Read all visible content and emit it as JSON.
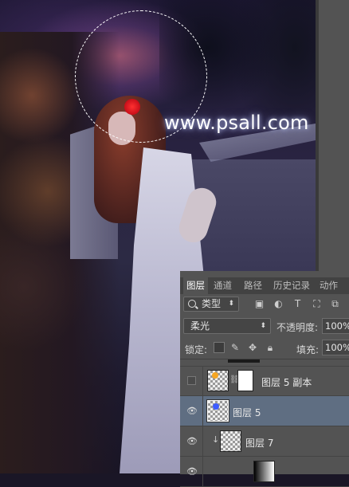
{
  "canvas": {
    "watermark_text": "www.psall.com"
  },
  "panel": {
    "tabs": [
      {
        "label": "图层",
        "active": true
      },
      {
        "label": "通道",
        "active": false
      },
      {
        "label": "路径",
        "active": false
      },
      {
        "label": "历史记录",
        "active": false
      },
      {
        "label": "动作",
        "active": false
      }
    ],
    "filter": {
      "kind_label": "类型",
      "icons": [
        "image-filter-icon",
        "adjustment-filter-icon",
        "type-filter-icon",
        "shape-filter-icon",
        "smart-object-filter-icon"
      ]
    },
    "blend_mode": "柔光",
    "opacity_label": "不透明度:",
    "opacity_value": "100%",
    "lock_label": "锁定:",
    "fill_label": "填充:",
    "fill_value": "100%",
    "layers": [
      {
        "name": "图层 5 副本",
        "visible": false,
        "selected": false,
        "has_mask": true
      },
      {
        "name": "图层 5",
        "visible": true,
        "selected": true,
        "has_mask": false
      },
      {
        "name": "图层 7",
        "visible": true,
        "selected": false,
        "clipped": true
      }
    ]
  },
  "colors": {
    "panel_bg": "#535353",
    "selected_layer_bg": "#5f6e82",
    "thumb_dot_orange": "#f6a623",
    "thumb_dot_blue": "#3c5bff"
  }
}
